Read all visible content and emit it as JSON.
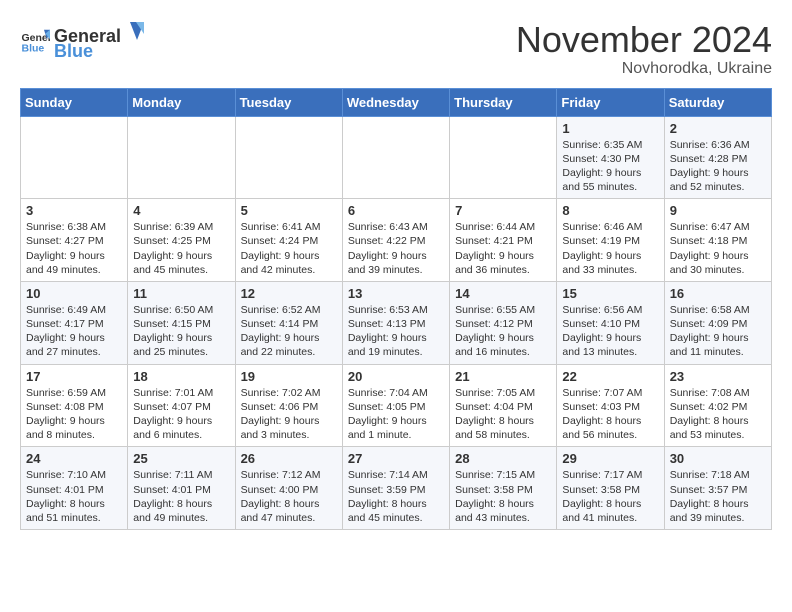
{
  "header": {
    "logo_general": "General",
    "logo_blue": "Blue",
    "title": "November 2024",
    "subtitle": "Novhorodka, Ukraine"
  },
  "weekdays": [
    "Sunday",
    "Monday",
    "Tuesday",
    "Wednesday",
    "Thursday",
    "Friday",
    "Saturday"
  ],
  "weeks": [
    [
      {
        "day": "",
        "info": ""
      },
      {
        "day": "",
        "info": ""
      },
      {
        "day": "",
        "info": ""
      },
      {
        "day": "",
        "info": ""
      },
      {
        "day": "",
        "info": ""
      },
      {
        "day": "1",
        "info": "Sunrise: 6:35 AM\nSunset: 4:30 PM\nDaylight: 9 hours\nand 55 minutes."
      },
      {
        "day": "2",
        "info": "Sunrise: 6:36 AM\nSunset: 4:28 PM\nDaylight: 9 hours\nand 52 minutes."
      }
    ],
    [
      {
        "day": "3",
        "info": "Sunrise: 6:38 AM\nSunset: 4:27 PM\nDaylight: 9 hours\nand 49 minutes."
      },
      {
        "day": "4",
        "info": "Sunrise: 6:39 AM\nSunset: 4:25 PM\nDaylight: 9 hours\nand 45 minutes."
      },
      {
        "day": "5",
        "info": "Sunrise: 6:41 AM\nSunset: 4:24 PM\nDaylight: 9 hours\nand 42 minutes."
      },
      {
        "day": "6",
        "info": "Sunrise: 6:43 AM\nSunset: 4:22 PM\nDaylight: 9 hours\nand 39 minutes."
      },
      {
        "day": "7",
        "info": "Sunrise: 6:44 AM\nSunset: 4:21 PM\nDaylight: 9 hours\nand 36 minutes."
      },
      {
        "day": "8",
        "info": "Sunrise: 6:46 AM\nSunset: 4:19 PM\nDaylight: 9 hours\nand 33 minutes."
      },
      {
        "day": "9",
        "info": "Sunrise: 6:47 AM\nSunset: 4:18 PM\nDaylight: 9 hours\nand 30 minutes."
      }
    ],
    [
      {
        "day": "10",
        "info": "Sunrise: 6:49 AM\nSunset: 4:17 PM\nDaylight: 9 hours\nand 27 minutes."
      },
      {
        "day": "11",
        "info": "Sunrise: 6:50 AM\nSunset: 4:15 PM\nDaylight: 9 hours\nand 25 minutes."
      },
      {
        "day": "12",
        "info": "Sunrise: 6:52 AM\nSunset: 4:14 PM\nDaylight: 9 hours\nand 22 minutes."
      },
      {
        "day": "13",
        "info": "Sunrise: 6:53 AM\nSunset: 4:13 PM\nDaylight: 9 hours\nand 19 minutes."
      },
      {
        "day": "14",
        "info": "Sunrise: 6:55 AM\nSunset: 4:12 PM\nDaylight: 9 hours\nand 16 minutes."
      },
      {
        "day": "15",
        "info": "Sunrise: 6:56 AM\nSunset: 4:10 PM\nDaylight: 9 hours\nand 13 minutes."
      },
      {
        "day": "16",
        "info": "Sunrise: 6:58 AM\nSunset: 4:09 PM\nDaylight: 9 hours\nand 11 minutes."
      }
    ],
    [
      {
        "day": "17",
        "info": "Sunrise: 6:59 AM\nSunset: 4:08 PM\nDaylight: 9 hours\nand 8 minutes."
      },
      {
        "day": "18",
        "info": "Sunrise: 7:01 AM\nSunset: 4:07 PM\nDaylight: 9 hours\nand 6 minutes."
      },
      {
        "day": "19",
        "info": "Sunrise: 7:02 AM\nSunset: 4:06 PM\nDaylight: 9 hours\nand 3 minutes."
      },
      {
        "day": "20",
        "info": "Sunrise: 7:04 AM\nSunset: 4:05 PM\nDaylight: 9 hours\nand 1 minute."
      },
      {
        "day": "21",
        "info": "Sunrise: 7:05 AM\nSunset: 4:04 PM\nDaylight: 8 hours\nand 58 minutes."
      },
      {
        "day": "22",
        "info": "Sunrise: 7:07 AM\nSunset: 4:03 PM\nDaylight: 8 hours\nand 56 minutes."
      },
      {
        "day": "23",
        "info": "Sunrise: 7:08 AM\nSunset: 4:02 PM\nDaylight: 8 hours\nand 53 minutes."
      }
    ],
    [
      {
        "day": "24",
        "info": "Sunrise: 7:10 AM\nSunset: 4:01 PM\nDaylight: 8 hours\nand 51 minutes."
      },
      {
        "day": "25",
        "info": "Sunrise: 7:11 AM\nSunset: 4:01 PM\nDaylight: 8 hours\nand 49 minutes."
      },
      {
        "day": "26",
        "info": "Sunrise: 7:12 AM\nSunset: 4:00 PM\nDaylight: 8 hours\nand 47 minutes."
      },
      {
        "day": "27",
        "info": "Sunrise: 7:14 AM\nSunset: 3:59 PM\nDaylight: 8 hours\nand 45 minutes."
      },
      {
        "day": "28",
        "info": "Sunrise: 7:15 AM\nSunset: 3:58 PM\nDaylight: 8 hours\nand 43 minutes."
      },
      {
        "day": "29",
        "info": "Sunrise: 7:17 AM\nSunset: 3:58 PM\nDaylight: 8 hours\nand 41 minutes."
      },
      {
        "day": "30",
        "info": "Sunrise: 7:18 AM\nSunset: 3:57 PM\nDaylight: 8 hours\nand 39 minutes."
      }
    ]
  ]
}
